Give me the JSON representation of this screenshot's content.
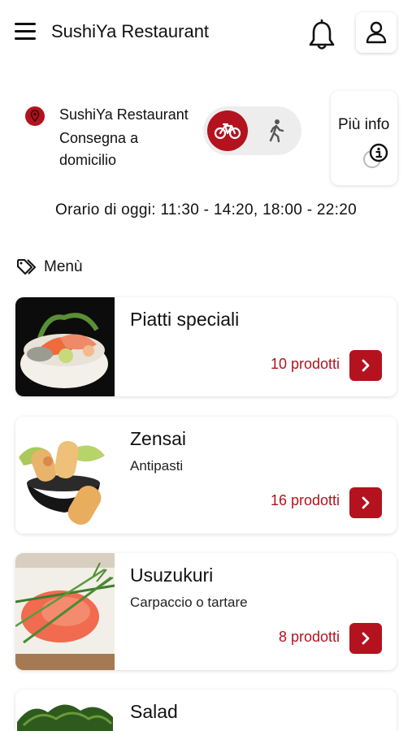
{
  "header": {
    "title": "SushiYa Restaurant",
    "menu_icon": "hamburger-menu-icon",
    "bell_icon": "bell-icon",
    "user_icon": "user-icon"
  },
  "restaurant": {
    "name": "SushiYa Restaurant",
    "mode_label": "Consegna a domicilio",
    "delivery_mode": "bike",
    "info_label": "Più info",
    "hours": "Orario di oggi: 11:30 - 14:20, 18:00 - 22:20"
  },
  "menu": {
    "label": "Menù",
    "categories": [
      {
        "title": "Piatti speciali",
        "subtitle": "",
        "count": "10 prodotti"
      },
      {
        "title": "Zensai",
        "subtitle": "Antipasti",
        "count": "16 prodotti"
      },
      {
        "title": "Usuzukuri",
        "subtitle": "Carpaccio o tartare",
        "count": "8 prodotti"
      },
      {
        "title": "Salad",
        "subtitle": "",
        "count": ""
      }
    ]
  },
  "colors": {
    "accent": "#b3121e",
    "toggle_bg": "#ededed",
    "text": "#111111"
  }
}
